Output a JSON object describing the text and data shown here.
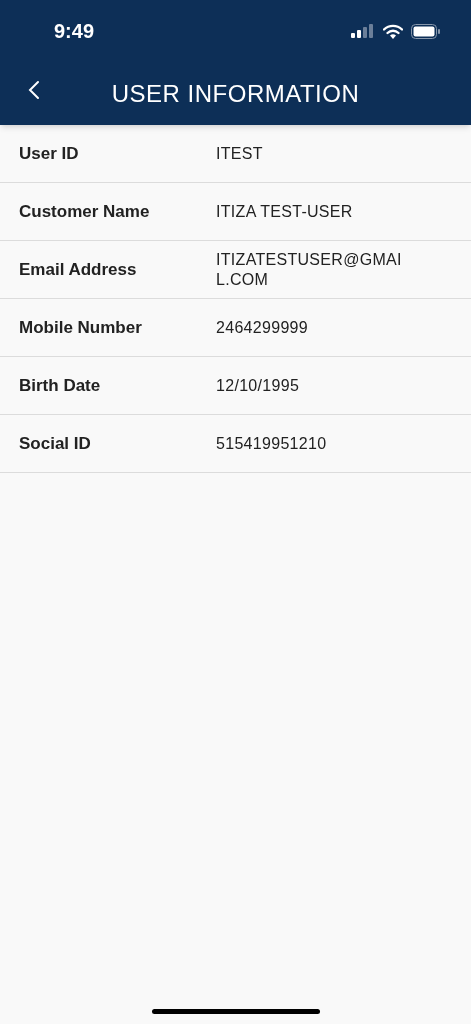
{
  "status_bar": {
    "time": "9:49"
  },
  "header": {
    "title": "USER INFORMATION"
  },
  "fields": [
    {
      "label": "User ID",
      "value": "ITEST"
    },
    {
      "label": "Customer Name",
      "value": "ITIZA TEST-USER"
    },
    {
      "label": "Email Address",
      "value": "ITIZATESTUSER@GMAIL.COM"
    },
    {
      "label": "Mobile Number",
      "value": "2464299999"
    },
    {
      "label": "Birth Date",
      "value": "12/10/1995"
    },
    {
      "label": "Social ID",
      "value": "515419951210"
    }
  ]
}
